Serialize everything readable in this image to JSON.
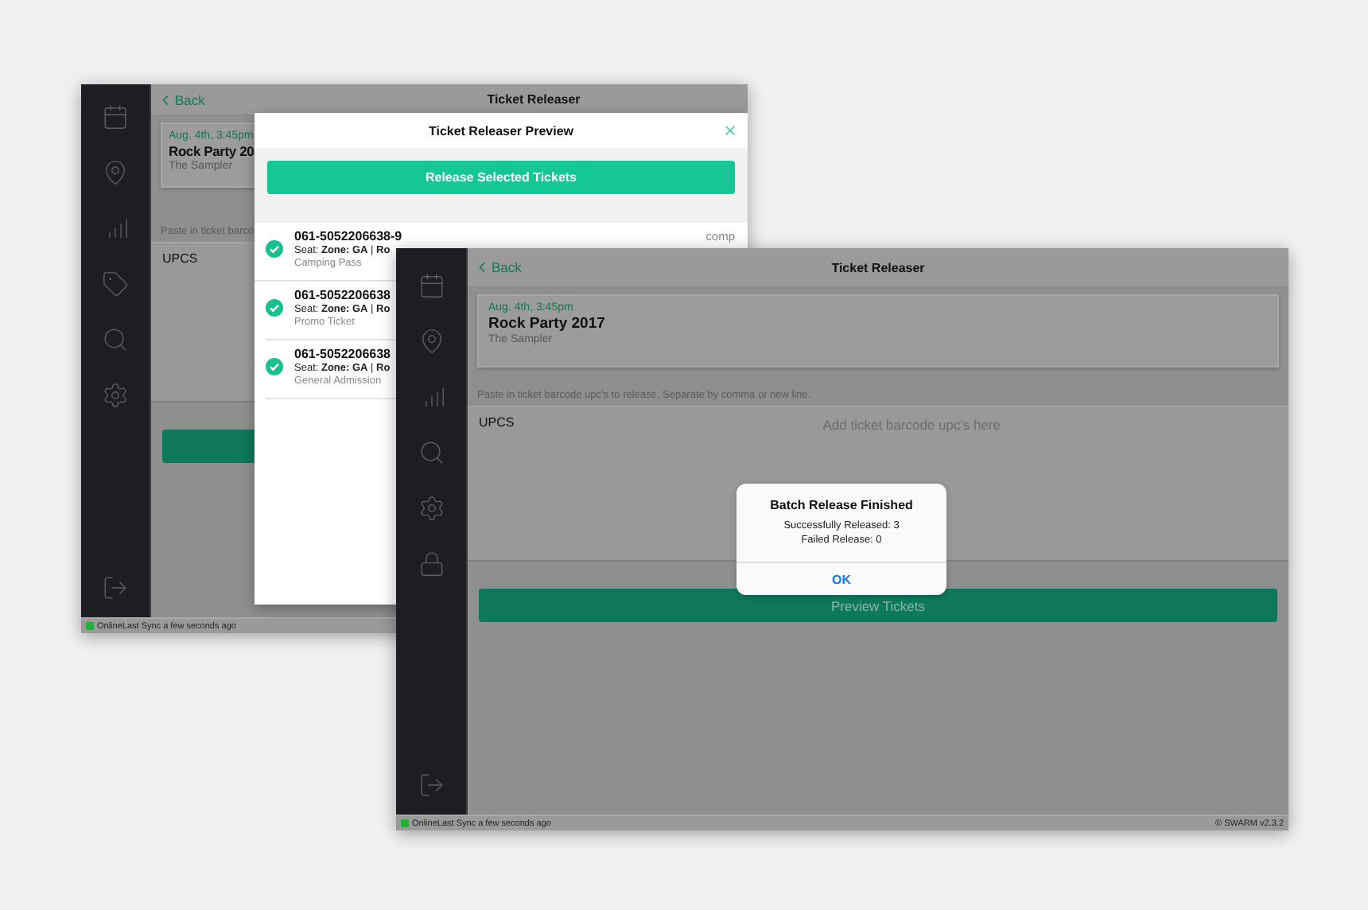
{
  "back_window": {
    "nav": {
      "back": "Back",
      "title": "Ticket Releaser"
    },
    "event": {
      "date": "Aug. 4th, 3:45pm",
      "name": "Rock Party 20",
      "venue": "The Sampler"
    },
    "instructions": "Paste in ticket barco",
    "upcs_label": "UPCS",
    "status": {
      "online": true,
      "text": "OnlineLast Sync a few seconds ago"
    },
    "modal": {
      "title": "Ticket Releaser Preview",
      "action": "Release Selected Tickets",
      "tickets": [
        {
          "code": "061-5052206638-9",
          "seat": "Seat: **Zone: GA** | **Ro**",
          "type": "Camping Pass",
          "tag": "comp",
          "checked": true
        },
        {
          "code": "061-5052206638",
          "seat": "Seat: **Zone: GA** | **Ro**",
          "type": "Promo Ticket",
          "checked": true
        },
        {
          "code": "061-5052206638",
          "seat": "Seat: **Zone: GA** | **Ro**",
          "type": "General Admission",
          "checked": true
        }
      ]
    }
  },
  "front_window": {
    "nav": {
      "back": "Back",
      "title": "Ticket Releaser"
    },
    "event": {
      "date": "Aug. 4th, 3:45pm",
      "name": "Rock Party 2017",
      "venue": "The Sampler"
    },
    "instructions": "Paste in ticket barcode upc's to release. Separate by comma or new line.",
    "upcs_label": "UPCS",
    "upcs_placeholder": "Add ticket barcode upc's here",
    "primary_action": "Preview Tickets",
    "status": {
      "online": true,
      "text": "OnlineLast Sync a few seconds ago"
    },
    "version": "© SWARM v2.3.2",
    "alert": {
      "title": "Batch Release Finished",
      "lines": [
        "Successfully Released: 3",
        "Failed Release: 0"
      ],
      "button": "OK"
    }
  }
}
